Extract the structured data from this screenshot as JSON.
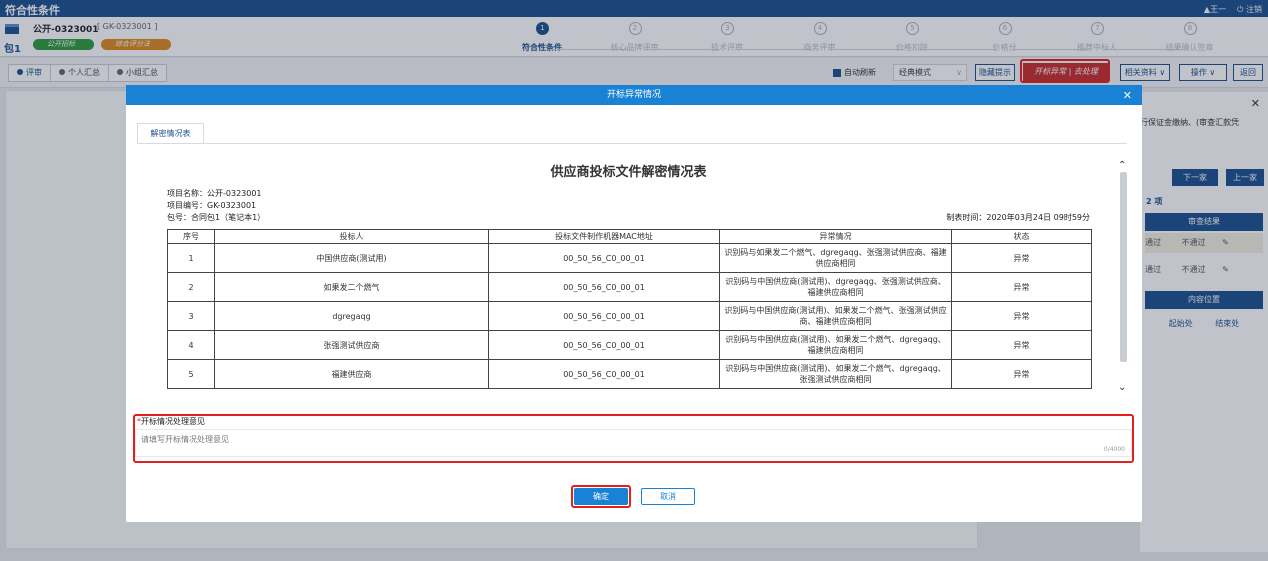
{
  "app": {
    "title": "符合性条件",
    "user": "▲王一",
    "logout": "⏻ 注销"
  },
  "project": {
    "name": "公开-0323001",
    "code": "[ GK-0323001 ]",
    "package": "包1",
    "badge_green": "公开招标",
    "badge_orange": "综合评分法"
  },
  "steps": [
    {
      "num": "1",
      "label": "符合性条件",
      "active": true
    },
    {
      "num": "2",
      "label": "核心品牌评审",
      "active": false
    },
    {
      "num": "3",
      "label": "技术评审",
      "active": false
    },
    {
      "num": "4",
      "label": "商务评审",
      "active": false
    },
    {
      "num": "5",
      "label": "价格扣除",
      "active": false
    },
    {
      "num": "6",
      "label": "价格分",
      "active": false
    },
    {
      "num": "7",
      "label": "推荐中标人",
      "active": false
    },
    {
      "num": "8",
      "label": "结果确认签章",
      "active": false
    }
  ],
  "toolbar": {
    "tabs": [
      "评审",
      "个人汇总",
      "小组汇总"
    ],
    "auto_refresh": "自动刷新",
    "mode": "经典模式",
    "hide_hint": "隐藏提示",
    "kaibiao": "开标异常 | 去处理",
    "materials": "相关资料 ∨",
    "operate": "操作 ∨",
    "back": "返回"
  },
  "right_panel": {
    "text": "行保证金缴纳、(审查汇款凭",
    "next": "下一家",
    "prev": "上一家",
    "count": "2 项",
    "result_head": "审查结果",
    "pass": "通过",
    "fail": "不通过",
    "location_head": "内容位置",
    "start": "起始处",
    "end": "结束处"
  },
  "modal": {
    "title": "开标异常情况",
    "tab": "解密情况表",
    "doc_title": "供应商投标文件解密情况表",
    "meta": {
      "project_name": "项目名称：公开-0323001",
      "project_code": "项目编号：GK-0323001",
      "package": "包号：合同包1（笔记本1）",
      "made_time": "制表时间：2020年03月24日 09时59分"
    },
    "columns": [
      "序号",
      "投标人",
      "投标文件制作机器MAC地址",
      "异常情况",
      "状态"
    ],
    "rows": [
      [
        "1",
        "中国供应商(测试用)",
        "00_50_56_C0_00_01",
        "识别码与如果发二个燃气、dgregaqg、张强测试供应商、福建供应商相同",
        "异常"
      ],
      [
        "2",
        "如果发二个燃气",
        "00_50_56_C0_00_01",
        "识别码与中国供应商(测试用)、dgregaqg、张强测试供应商、福建供应商相同",
        "异常"
      ],
      [
        "3",
        "dgregaqg",
        "00_50_56_C0_00_01",
        "识别码与中国供应商(测试用)、如果发二个燃气、张强测试供应商、福建供应商相同",
        "异常"
      ],
      [
        "4",
        "张强测试供应商",
        "00_50_56_C0_00_01",
        "识别码与中国供应商(测试用)、如果发二个燃气、dgregaqg、福建供应商相同",
        "异常"
      ],
      [
        "5",
        "福建供应商",
        "00_50_56_C0_00_01",
        "识别码与中国供应商(测试用)、如果发二个燃气、dgregaqg、张强测试供应商相同",
        "异常"
      ]
    ],
    "opinion_label": "开标情况处理意见",
    "opinion_placeholder": "请填写开标情况处理意见",
    "counter": "0/4000",
    "ok": "确定",
    "cancel": "取消"
  }
}
